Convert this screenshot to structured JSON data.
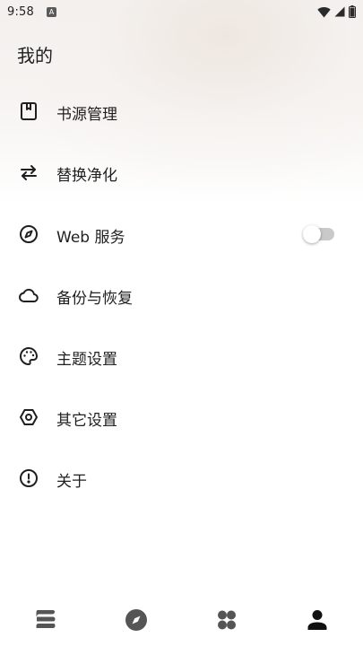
{
  "status_bar": {
    "time": "9:58",
    "notification_glyph": "A",
    "icons": [
      "wifi-icon",
      "cellular-signal-icon",
      "battery-icon"
    ]
  },
  "page": {
    "title": "我的"
  },
  "menu": {
    "items": [
      {
        "label": "书源管理",
        "icon": "book-source-icon"
      },
      {
        "label": "替换净化",
        "icon": "swap-arrows-icon"
      },
      {
        "label": "Web 服务",
        "icon": "compass-icon",
        "toggle": {
          "on": false
        }
      },
      {
        "label": "备份与恢复",
        "icon": "cloud-icon"
      },
      {
        "label": "主题设置",
        "icon": "palette-icon"
      },
      {
        "label": "其它设置",
        "icon": "hexagon-settings-icon"
      },
      {
        "label": "关于",
        "icon": "info-exclamation-icon"
      }
    ]
  },
  "bottom_nav": {
    "items": [
      {
        "icon": "bookshelf-icon",
        "active": false
      },
      {
        "icon": "explore-compass-icon",
        "active": false
      },
      {
        "icon": "rss-grid-icon",
        "active": false
      },
      {
        "icon": "profile-person-icon",
        "active": true
      }
    ]
  },
  "colors": {
    "text": "#1f1f1f",
    "icon": "#1f1f1f",
    "nav_icon_inactive": "#555555",
    "nav_icon_active": "#111111",
    "toggle_track_off": "#c9c9c9",
    "toggle_thumb": "#ffffff"
  }
}
